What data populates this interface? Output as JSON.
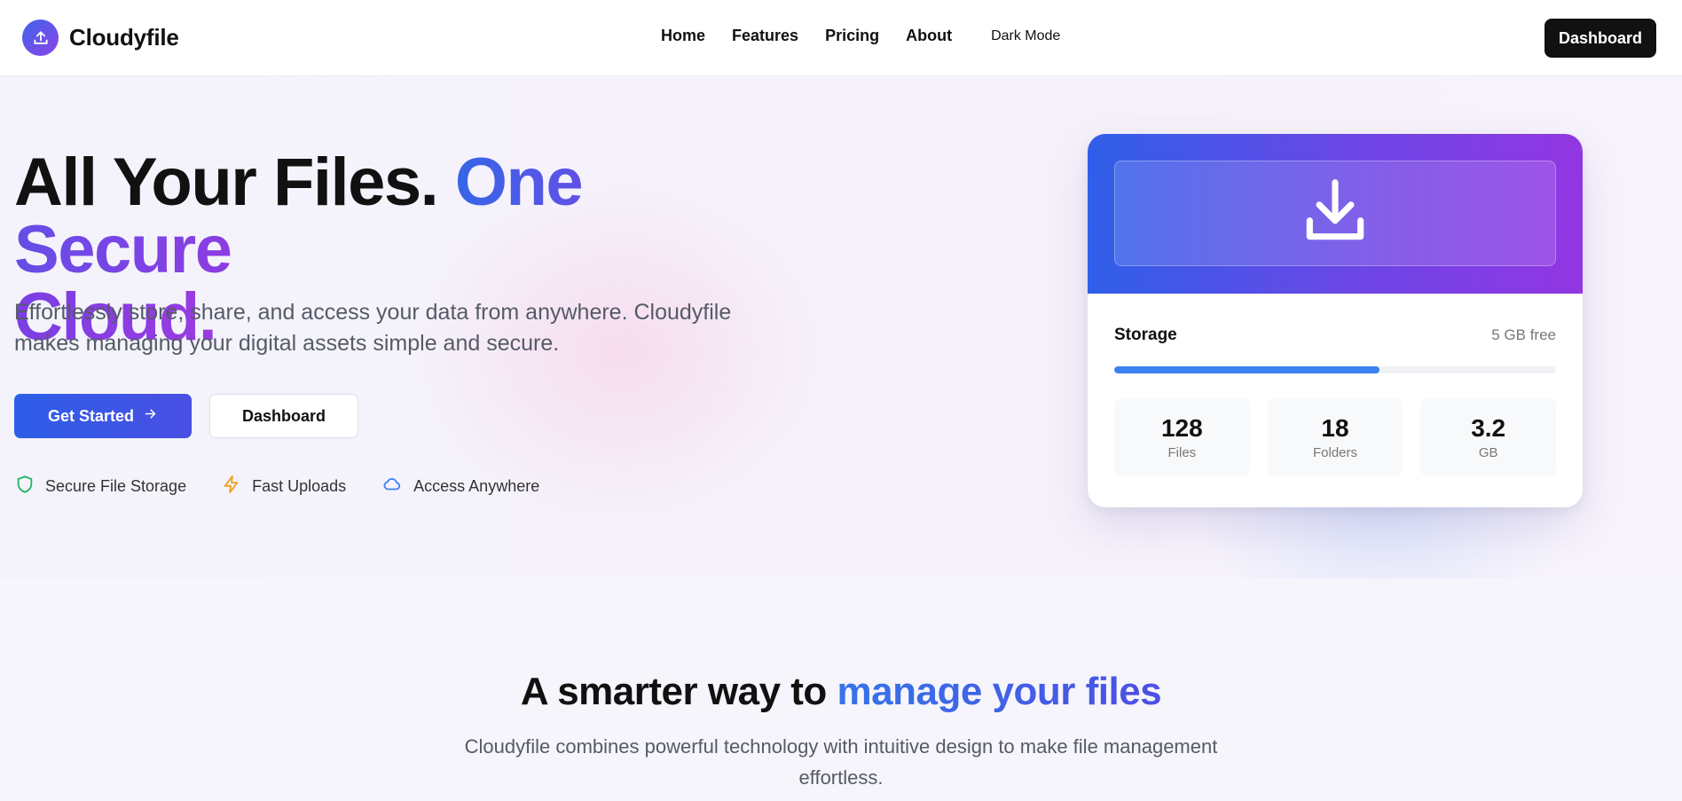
{
  "nav": {
    "brand": "Cloudyfile",
    "links": [
      "Home",
      "Features",
      "Pricing",
      "About"
    ],
    "dark_mode": "Dark Mode",
    "dashboard": "Dashboard"
  },
  "hero": {
    "headline_plain": "All Your Files. ",
    "headline_accent_1": "One Secure",
    "headline_accent_2": "Cloud.",
    "subtext": "Effortlessly store, share, and access your data from anywhere. Cloudyfile makes managing your digital assets simple and secure.",
    "cta_primary": "Get Started",
    "cta_secondary": "Dashboard",
    "features": [
      {
        "label": "Secure File Storage",
        "icon": "shield-icon",
        "color": "#22b35e"
      },
      {
        "label": "Fast Uploads",
        "icon": "lightning-icon",
        "color": "#f0a020"
      },
      {
        "label": "Access Anywhere",
        "icon": "cloud-icon",
        "color": "#3b82f0"
      }
    ]
  },
  "card": {
    "storage_title": "Storage",
    "storage_free": "5 GB free",
    "storage_used_fraction": 0.6,
    "stats": [
      {
        "value": "128",
        "label": "Files"
      },
      {
        "value": "18",
        "label": "Folders"
      },
      {
        "value": "3.2",
        "label": "GB"
      }
    ]
  },
  "section": {
    "title_plain": "A smarter way to ",
    "title_accent": "manage your files",
    "subtitle": "Cloudyfile combines powerful technology with intuitive design to make file management effortless."
  },
  "colors": {
    "brand_blue": "#2f5fe8",
    "brand_purple": "#9236e2",
    "nav_button": "#111111"
  }
}
